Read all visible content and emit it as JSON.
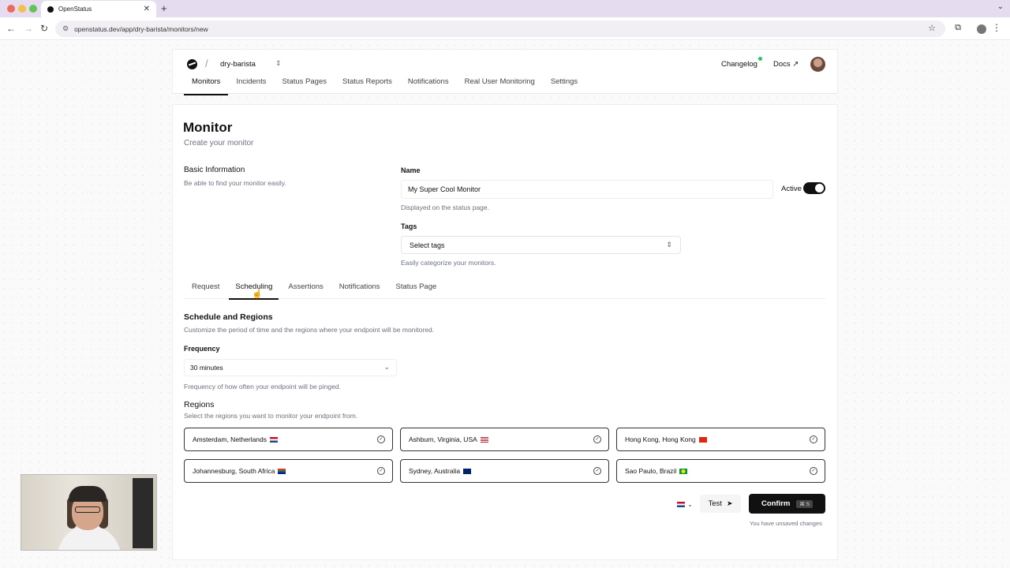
{
  "browser": {
    "tab_title": "OpenStatus",
    "url": "openstatus.dev/app/dry-barista/monitors/new"
  },
  "header": {
    "project": "dry-barista",
    "changelog": "Changelog",
    "docs": "Docs ↗",
    "nav": [
      "Monitors",
      "Incidents",
      "Status Pages",
      "Status Reports",
      "Notifications",
      "Real User Monitoring",
      "Settings"
    ]
  },
  "page": {
    "title": "Monitor",
    "subtitle": "Create your monitor"
  },
  "basic_info": {
    "title": "Basic Information",
    "desc": "Be able to find your monitor easily.",
    "name_label": "Name",
    "name_value": "My Super Cool Monitor",
    "name_help": "Displayed on the status page.",
    "active_label": "Active",
    "active": true,
    "tags_label": "Tags",
    "tags_placeholder": "Select tags",
    "tags_help": "Easily categorize your monitors."
  },
  "tabs": [
    "Request",
    "Scheduling",
    "Assertions",
    "Notifications",
    "Status Page"
  ],
  "active_tab": "Scheduling",
  "scheduling": {
    "title": "Schedule and Regions",
    "desc": "Customize the period of time and the regions where your endpoint will be monitored.",
    "frequency_label": "Frequency",
    "frequency_value": "30 minutes",
    "frequency_help": "Frequency of how often your endpoint will be pinged.",
    "regions_title": "Regions",
    "regions_desc": "Select the regions you want to monitor your endpoint from.",
    "regions": [
      {
        "label": "Amsterdam, Netherlands",
        "flag": "nl",
        "selected": true
      },
      {
        "label": "Ashburn, Virginia, USA",
        "flag": "us",
        "selected": true
      },
      {
        "label": "Hong Kong, Hong Kong",
        "flag": "hk",
        "selected": true
      },
      {
        "label": "Johannesburg, South Africa",
        "flag": "za",
        "selected": true
      },
      {
        "label": "Sydney, Australia",
        "flag": "au",
        "selected": true
      },
      {
        "label": "Sao Paulo, Brazil",
        "flag": "br",
        "selected": true
      }
    ]
  },
  "actions": {
    "test_label": "Test",
    "confirm_label": "Confirm",
    "confirm_shortcut": "⌘ S",
    "unsaved": "You have unsaved changes"
  }
}
